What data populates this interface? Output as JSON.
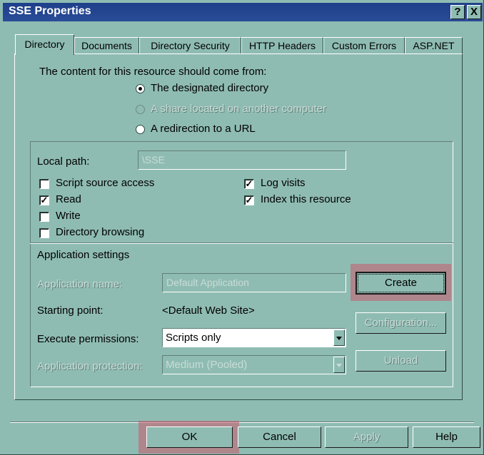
{
  "window": {
    "title": "SSE Properties",
    "help_glyph": "?",
    "close_glyph": "X"
  },
  "tabs": [
    {
      "label": "Directory"
    },
    {
      "label": "Documents"
    },
    {
      "label": "Directory Security"
    },
    {
      "label": "HTTP Headers"
    },
    {
      "label": "Custom Errors"
    },
    {
      "label": "ASP.NET"
    }
  ],
  "source": {
    "prompt": "The content for this resource should come from:",
    "options": [
      {
        "label": "The designated directory",
        "selected": true,
        "enabled": true
      },
      {
        "label": "A share located on another computer",
        "selected": false,
        "enabled": false
      },
      {
        "label": "A redirection to a URL",
        "selected": false,
        "enabled": true
      }
    ]
  },
  "local_path": {
    "label": "Local path:",
    "value": "\\SSE"
  },
  "checkboxes": {
    "script_source_access": {
      "label": "Script source access",
      "checked": false
    },
    "read": {
      "label": "Read",
      "checked": true
    },
    "write": {
      "label": "Write",
      "checked": false
    },
    "directory_browsing": {
      "label": "Directory browsing",
      "checked": false
    },
    "log_visits": {
      "label": "Log visits",
      "checked": true
    },
    "index_resource": {
      "label": "Index this resource",
      "checked": true
    }
  },
  "app_settings": {
    "heading": "Application settings",
    "app_name_label": "Application name:",
    "app_name_value": "Default Application",
    "starting_point_label": "Starting point:",
    "starting_point_value": "<Default Web Site>",
    "exec_perm_label": "Execute permissions:",
    "exec_perm_value": "Scripts only",
    "app_protection_label": "Application protection:",
    "app_protection_value": "Medium (Pooled)",
    "create_label": "Create",
    "configuration_label": "Configuration...",
    "unload_label": "Unload"
  },
  "footer": {
    "ok": "OK",
    "cancel": "Cancel",
    "apply": "Apply",
    "help": "Help"
  },
  "colors": {
    "dialog_bg": "#8fbcb2",
    "title_bar": "#1e3f8a",
    "highlight": "#c85a6e"
  }
}
